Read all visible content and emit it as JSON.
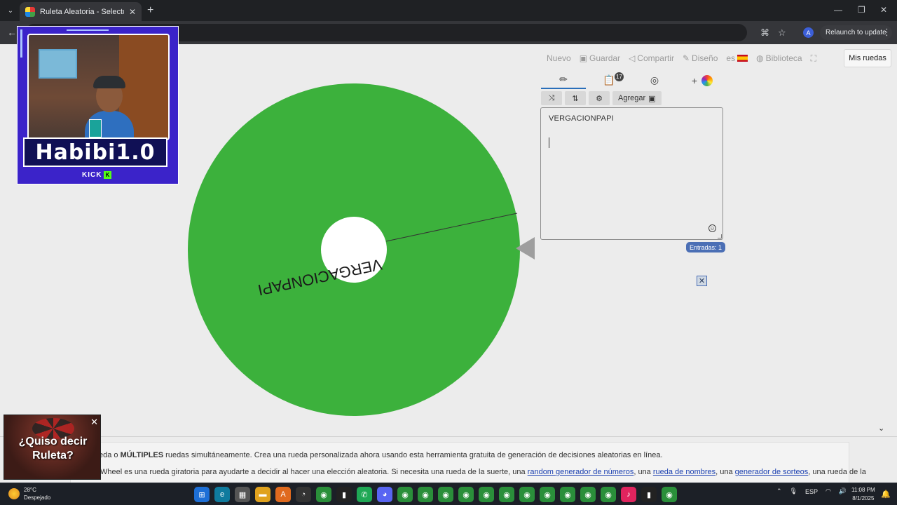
{
  "browser": {
    "tab_title": "Ruleta Aleatoria - Selector Person",
    "relaunch_label": "Relaunch to update",
    "profile_initial": "A"
  },
  "topnav": {
    "items": [
      "Nuevo",
      "Guardar",
      "Compartir",
      "Diseño",
      "es",
      "Biblioteca"
    ],
    "mis_ruedas": "Mis ruedas"
  },
  "wheel": {
    "color": "#3cb13c",
    "entries": [
      "VERGACIONPAPI"
    ]
  },
  "editor": {
    "agregar_label": "Agregar",
    "entries_text": "VERGACIONPAPI",
    "entradas_label": "Entradas: 1",
    "badge": "17"
  },
  "description": {
    "line1_pre": "eda o ",
    "line1_bold": "MÚLTIPLES",
    "line1_post": " ruedas simultáneamente. Crea una rueda personalizada ahora usando esta herramienta gratuita de generación de decisiones aleatorias en línea.",
    "line2_pre": "Wheel es una rueda giratoria para ayudarte a decidir al hacer una elección aleatoria. Si necesita una rueda de la suerte, una ",
    "link1": "random generador de números",
    "sep1": ", una ",
    "link2": "rueda de nombres",
    "sep2": ", una ",
    "link3": "generador de sorteos",
    "line2_post": ", una rueda de la"
  },
  "webcam": {
    "name": "Habibi1.0",
    "platform": "KICK"
  },
  "popup": {
    "text": "¿Quiso decir Ruleta?"
  },
  "taskbar": {
    "temp": "28°C",
    "weather": "Despejado",
    "lang": "ESP",
    "time": "11:08 PM",
    "date": "8/1/2025"
  }
}
